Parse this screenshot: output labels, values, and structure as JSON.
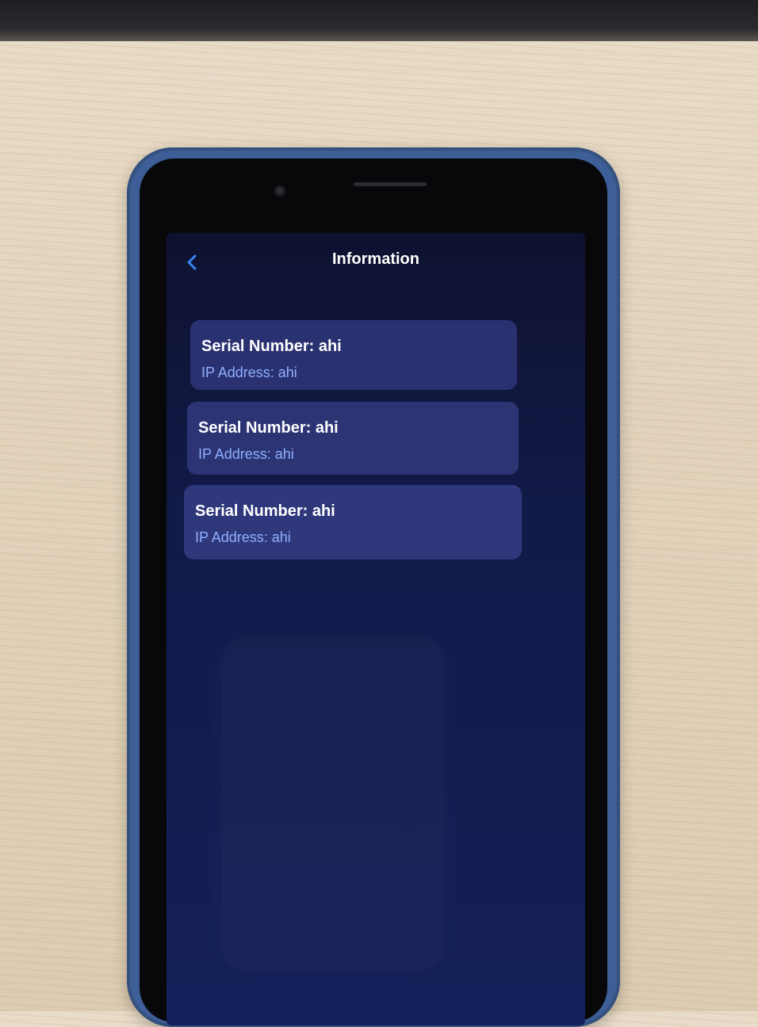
{
  "header": {
    "title": "Information",
    "back_icon": "chevron-left-icon"
  },
  "cards": [
    {
      "serial": "Serial Number: ahi",
      "ip": "IP Address: ahi"
    },
    {
      "serial": "Serial Number: ahi",
      "ip": "IP Address: ahi"
    },
    {
      "serial": "Serial Number: ahi",
      "ip": "IP Address: ahi"
    }
  ],
  "colors": {
    "background": "#121a48",
    "card": "#2d3576",
    "accent": "#3b82f6",
    "ip_text": "#8fb0ff"
  }
}
